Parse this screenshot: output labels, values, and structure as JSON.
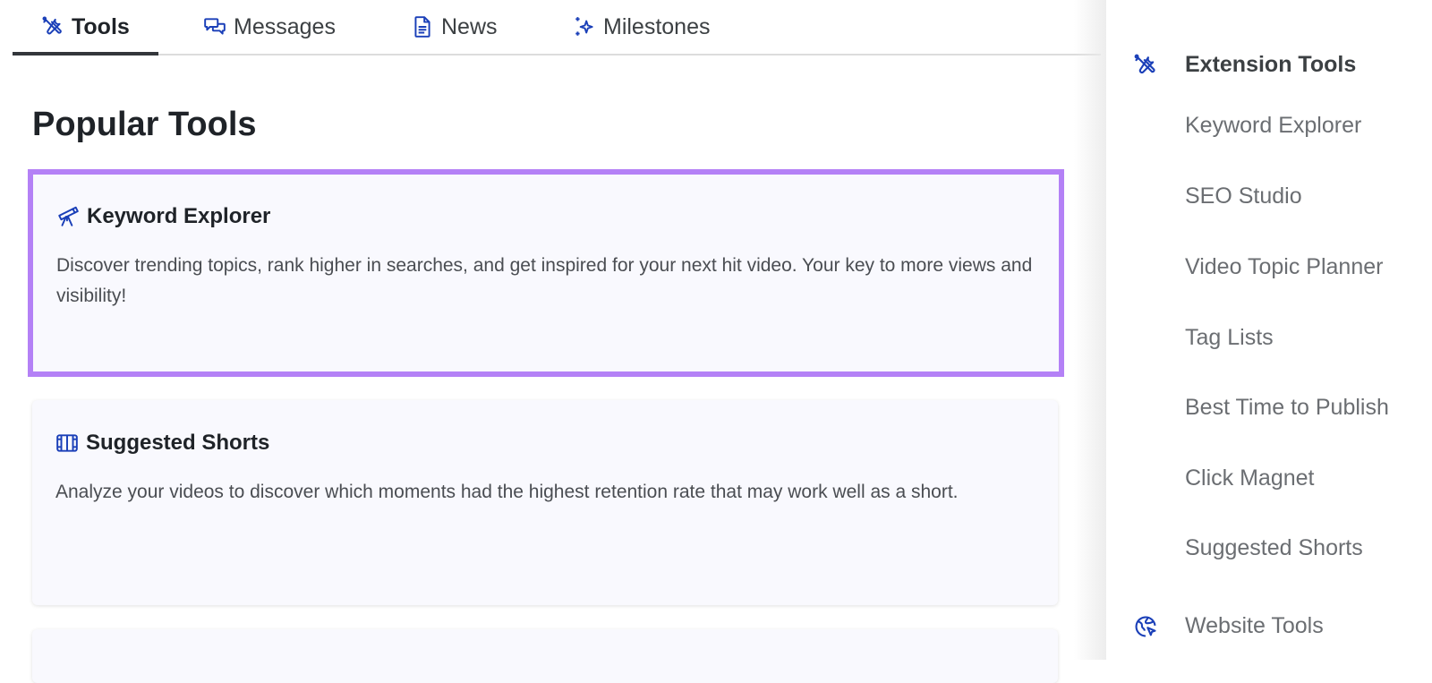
{
  "tabs": [
    {
      "label": "Tools",
      "icon": "tools-icon",
      "active": true
    },
    {
      "label": "Messages",
      "icon": "chat-bubbles-icon",
      "active": false
    },
    {
      "label": "News",
      "icon": "document-icon",
      "active": false
    },
    {
      "label": "Milestones",
      "icon": "sparkles-icon",
      "active": false
    }
  ],
  "page_title": "Popular Tools",
  "cards": [
    {
      "title": "Keyword Explorer",
      "icon": "telescope-icon",
      "description": "Discover trending topics, rank higher in searches, and get inspired for your next hit video. Your key to more views and visibility!",
      "highlighted": true
    },
    {
      "title": "Suggested Shorts",
      "icon": "film-strip-icon",
      "description": "Analyze your videos to discover which moments had the highest retention rate that may work well as a short.",
      "highlighted": false
    }
  ],
  "sidebar": {
    "extension_tools": {
      "label": "Extension Tools",
      "icon": "tools-icon",
      "items": [
        "Keyword Explorer",
        "SEO Studio",
        "Video Topic Planner",
        "Tag Lists",
        "Best Time to Publish",
        "Click Magnet",
        "Suggested Shorts"
      ]
    },
    "website_tools": {
      "label": "Website Tools",
      "icon": "globe-cursor-icon"
    }
  },
  "colors": {
    "accent_icon": "#1a3fb8",
    "highlight_border": "#b481f6",
    "card_background": "#f9f9fe"
  }
}
